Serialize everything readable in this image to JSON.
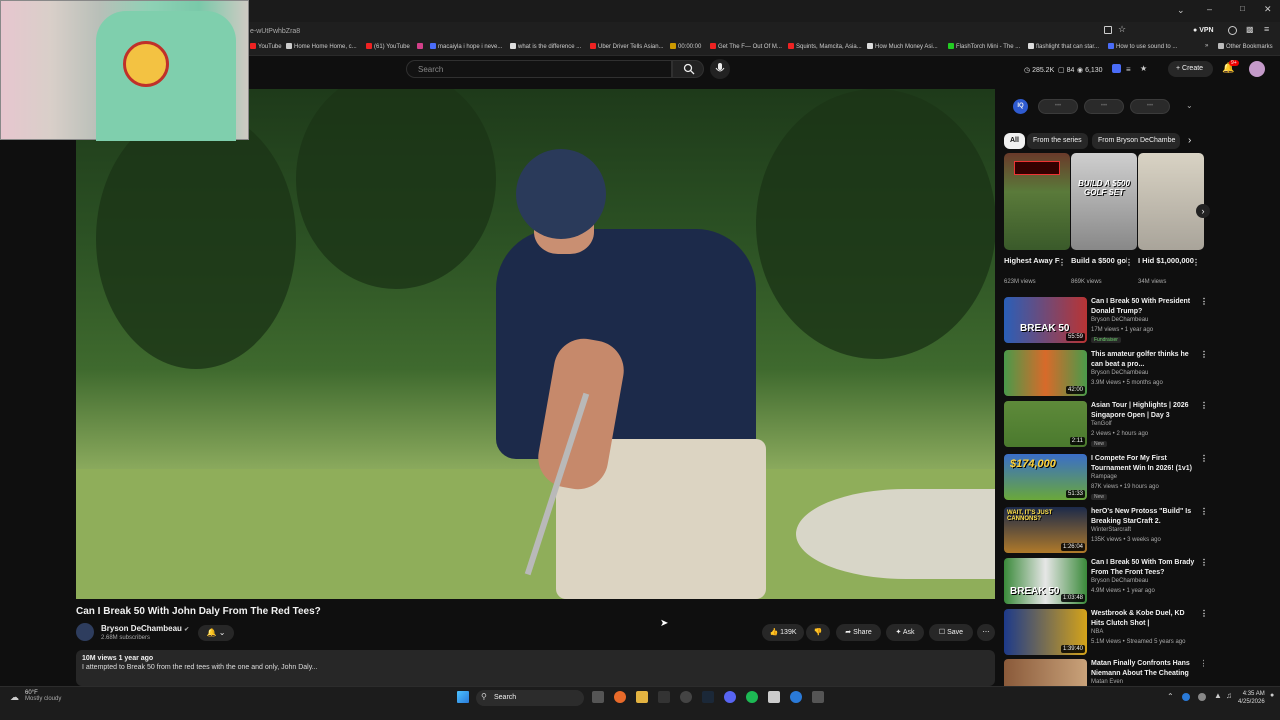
{
  "browser": {
    "url_fragment": "e-wUtPwhbZra8",
    "vpn": "VPN",
    "bookmarks": [
      "YouTube",
      "Home Home Home, c...",
      "(61) YouTube",
      "macaiyla i hope i neve...",
      "what is the difference ...",
      "Uber Driver Tells Asian...",
      "00:00:00",
      "Get The F— Out Of M...",
      "Squints, Mamcita, Asia...",
      "How Much Money Asi...",
      "FlashTorch Mini - The ...",
      "flashlight that can star...",
      "How to use sound to ...",
      "Other Bookmarks"
    ]
  },
  "header": {
    "search_placeholder": "Search",
    "stats": {
      "views": "285.2K",
      "likes": "84",
      "count": "6,130"
    },
    "create_label": "Create",
    "notif_count": "9+"
  },
  "video": {
    "title": "Can I Break 50 With John Daly From The Red Tees?",
    "channel": "Bryson DeChambeau",
    "subscribers": "2.68M subscribers",
    "likes": "139K",
    "share": "Share",
    "ask": "Ask",
    "save": "Save",
    "views_date": "10M views  1 year ago",
    "description": "I attempted to Break 50 from the red tees with the one and only, John Daly..."
  },
  "sidebar": {
    "lens": "IQ",
    "pills": [
      "•••",
      "•••",
      "•••"
    ],
    "chips": [
      "All",
      "From the series",
      "From Bryson DeChambe"
    ],
    "shorts": [
      {
        "title": "Highest Away From ...",
        "views": "623M views"
      },
      {
        "title": "Build a $500 golf set at ...",
        "views": "869K views",
        "overlay": "BUILD A $500 GOLF SET"
      },
      {
        "title": "I Hid $1,000,000 ...",
        "views": "34M views"
      }
    ],
    "recs": [
      {
        "title": "Can I Break 50 With President Donald Trump?",
        "channel": "Bryson DeChambeau",
        "meta": "17M views • 1 year ago",
        "badge": "Fundraiser",
        "dur": "55:59",
        "thumb": "BREAK 50"
      },
      {
        "title": "This amateur golfer thinks he can beat a pro...",
        "channel": "Bryson DeChambeau",
        "meta": "3.9M views • 5 months ago",
        "dur": "42:00",
        "thumb": ""
      },
      {
        "title": "Asian Tour | Highlights | 2026 Singapore Open | Day 3",
        "channel": "TenGolf",
        "meta": "2 views • 2 hours ago",
        "badge": "New",
        "dur": "2:11",
        "thumb": ""
      },
      {
        "title": "I Compete For My First Tournament Win In 2026! (1v1)",
        "channel": "Rampage",
        "meta": "87K views • 19 hours ago",
        "badge": "New",
        "dur": "51:33",
        "thumb": "$174,000"
      },
      {
        "title": "herO's New Protoss \"Build\" Is Breaking StarCraft 2.",
        "channel": "WinterStarcraft",
        "meta": "135K views • 3 weeks ago",
        "dur": "1:26:04",
        "thumb": "WAIT, IT'S JUST CANNONS?"
      },
      {
        "title": "Can I Break 50 With Tom Brady From The Front Tees?",
        "channel": "Bryson DeChambeau",
        "meta": "4.9M views • 1 year ago",
        "dur": "1:03:48",
        "thumb": "BREAK 50"
      },
      {
        "title": "Westbrook & Kobe Duel, KD Hits Clutch Shot | #NBATogetherLi...",
        "channel": "NBA",
        "meta": "5.1M views • Streamed 5 years ago",
        "dur": "1:39:40",
        "thumb": ""
      },
      {
        "title": "Matan Finally Confronts Hans Niemann About The Cheating ...",
        "channel": "Matan Even",
        "meta": "",
        "dur": "",
        "thumb": ""
      }
    ]
  },
  "taskbar": {
    "temp": "60°F",
    "weather": "Mostly cloudy",
    "search": "Search",
    "time": "4:35 AM",
    "date": "4/25/2026"
  },
  "colors": {
    "accent": "#ff0000",
    "bg": "#0f0f0f",
    "chip_bg": "#272727"
  }
}
